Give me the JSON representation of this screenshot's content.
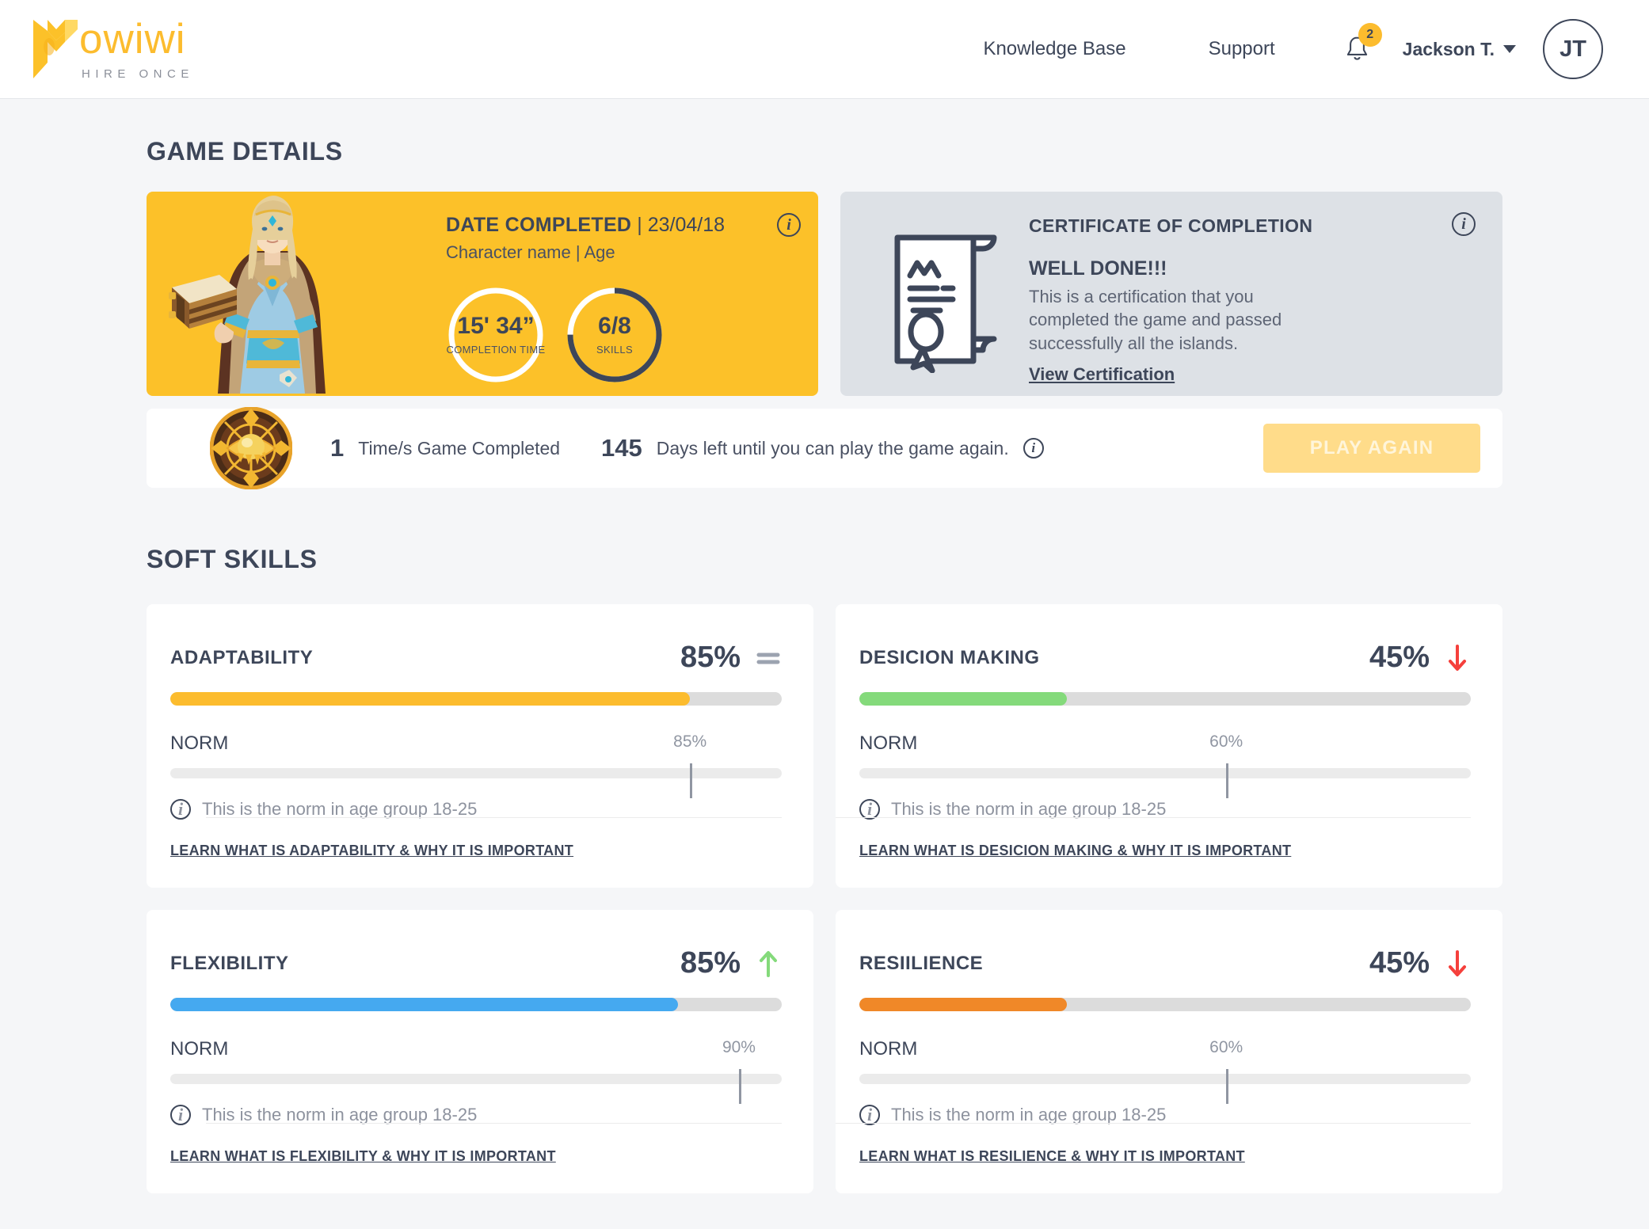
{
  "header": {
    "logo_word": "owiwi",
    "logo_tagline": "HIRE ONCE",
    "nav": [
      {
        "label": "Knowledge Base"
      },
      {
        "label": "Support"
      }
    ],
    "notifications_count": "2",
    "user_name": "Jackson T.",
    "avatar_initials": "JT"
  },
  "game_details": {
    "title": "GAME DETAILS",
    "date_label": "DATE COMPLETED",
    "date_separator": "|",
    "date_value": "23/04/18",
    "character_line": "Character name | Age",
    "info_glyph": "i",
    "rings": [
      {
        "value": "15' 34”",
        "caption": "COMPLETION TIME",
        "percent": 100,
        "style": "white"
      },
      {
        "value": "6/8",
        "caption": "SKILLS",
        "percent": 75,
        "style": "dark"
      }
    ],
    "certificate": {
      "heading": "CERTIFICATE OF COMPLETION",
      "well_done": "WELL DONE!!!",
      "description": "This is a certification that you completed the game and passed successfully all the islands.",
      "link": "View Certification",
      "info_glyph": "i"
    },
    "play_row": {
      "times_played": "1",
      "times_played_label": "Time/s Game Completed",
      "days_left": "145",
      "days_left_label": "Days left until you can play the game again.",
      "info_glyph": "i",
      "play_button": "PLAY AGAIN"
    }
  },
  "soft_skills": {
    "title": "SOFT SKILLS",
    "norm_label": "NORM",
    "norm_note": "This is the norm in age group 18-25",
    "info_glyph": "i",
    "cards": [
      {
        "name": "ADAPTABILITY",
        "percent_text": "85%",
        "percent": 85,
        "bar_color": "#fcbc2e",
        "trend": "equal",
        "norm_text": "85%",
        "norm": 85,
        "learn_link": "LEARN WHAT IS ADAPTABILITY & WHY IT IS IMPORTANT"
      },
      {
        "name": "DESICION MAKING",
        "percent_text": "45%",
        "percent": 34,
        "bar_color": "#84da7b",
        "trend": "down",
        "norm_text": "60%",
        "norm": 60,
        "learn_link": "LEARN WHAT IS DESICION MAKING & WHY IT IS IMPORTANT"
      },
      {
        "name": "FLEXIBILITY",
        "percent_text": "85%",
        "percent": 83,
        "bar_color": "#45a9f0",
        "trend": "up",
        "norm_text": "90%",
        "norm": 93,
        "learn_link": "LEARN WHAT IS FLEXIBILITY & WHY IT IS IMPORTANT"
      },
      {
        "name": "RESIILIENCE",
        "percent_text": "45%",
        "percent": 34,
        "bar_color": "#f08828",
        "trend": "down",
        "norm_text": "60%",
        "norm": 60,
        "learn_link": "LEARN WHAT IS RESILIENCE & WHY IT IS IMPORTANT"
      }
    ]
  },
  "colors": {
    "brand_yellow": "#fcc129",
    "navy": "#3d4659",
    "page_bg": "#f5f6f8",
    "cert_bg": "#dde1e6",
    "trend_up": "#84da7b",
    "trend_down": "#f5403c",
    "trend_equal": "#9ca3b0"
  }
}
